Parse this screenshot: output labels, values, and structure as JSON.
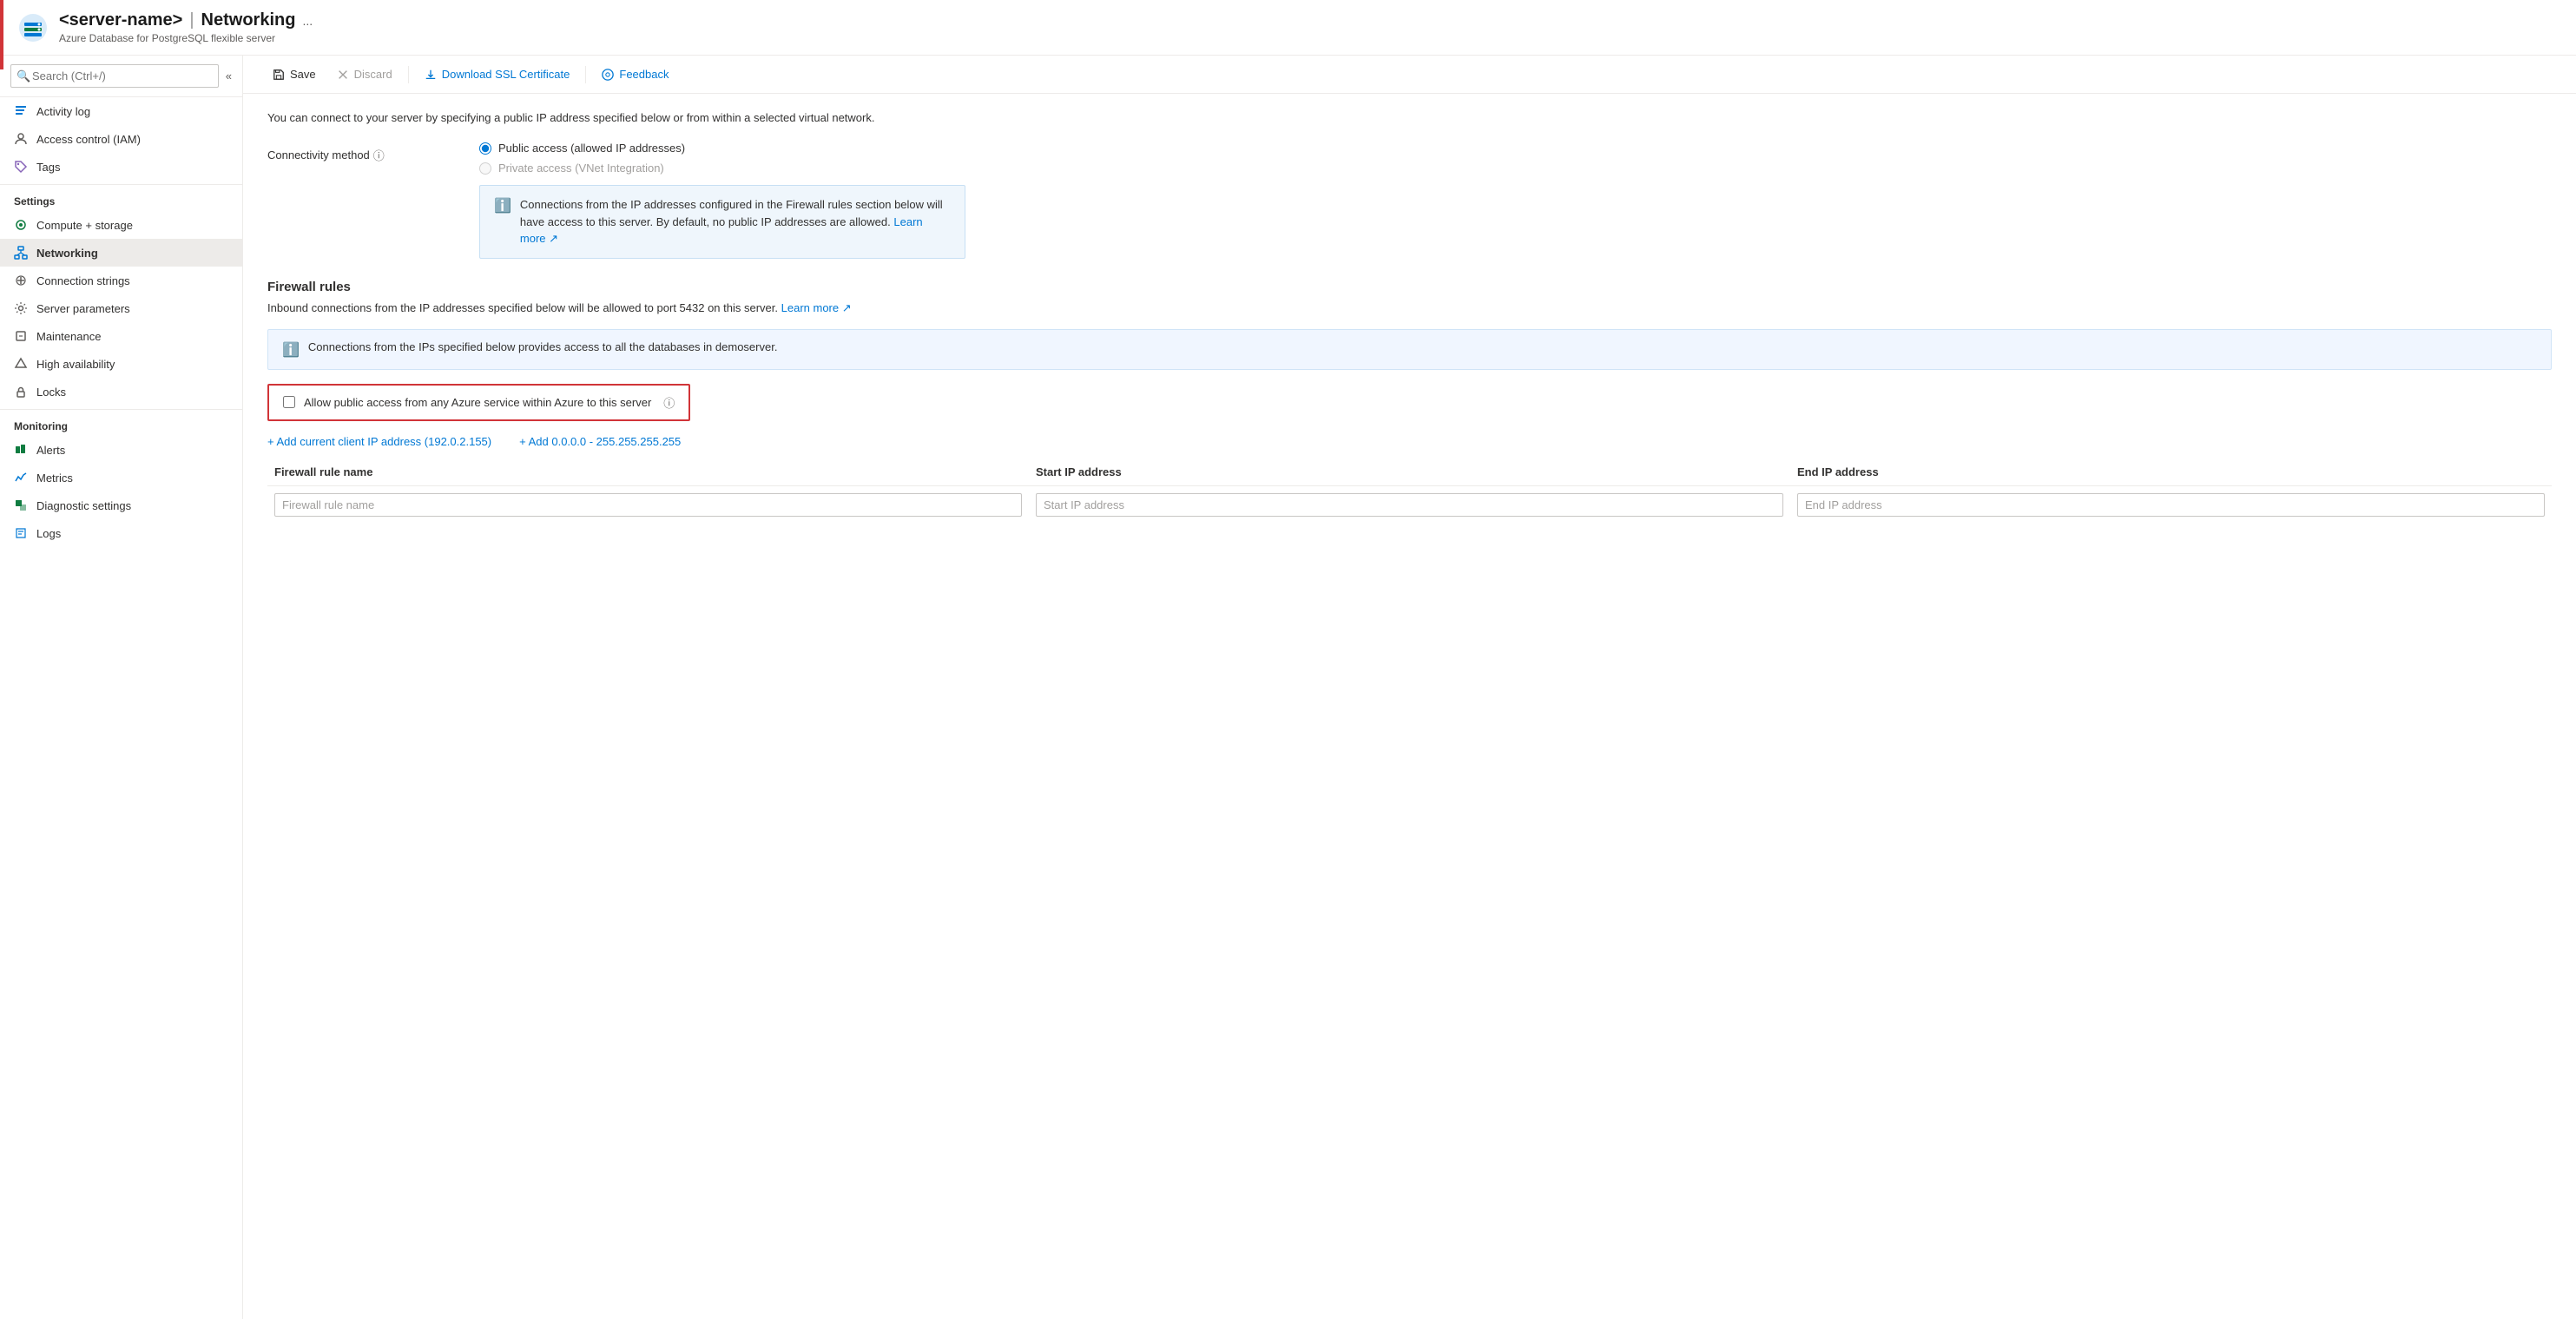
{
  "header": {
    "server_name": "<server-name>",
    "page_title": "Networking",
    "subtitle": "Azure Database for PostgreSQL flexible server",
    "more_label": "...",
    "icon_alt": "postgres-server-icon"
  },
  "toolbar": {
    "save_label": "Save",
    "discard_label": "Discard",
    "download_ssl_label": "Download SSL Certificate",
    "feedback_label": "Feedback"
  },
  "sidebar": {
    "search_placeholder": "Search (Ctrl+/)",
    "items_top": [
      {
        "id": "activity-log",
        "label": "Activity log",
        "icon": "activity"
      },
      {
        "id": "access-control",
        "label": "Access control (IAM)",
        "icon": "iam"
      },
      {
        "id": "tags",
        "label": "Tags",
        "icon": "tag"
      }
    ],
    "settings_label": "Settings",
    "settings_items": [
      {
        "id": "compute-storage",
        "label": "Compute + storage",
        "icon": "compute"
      },
      {
        "id": "networking",
        "label": "Networking",
        "icon": "networking",
        "active": true
      },
      {
        "id": "connection-strings",
        "label": "Connection strings",
        "icon": "connection"
      },
      {
        "id": "server-parameters",
        "label": "Server parameters",
        "icon": "settings"
      },
      {
        "id": "maintenance",
        "label": "Maintenance",
        "icon": "maintenance"
      },
      {
        "id": "high-availability",
        "label": "High availability",
        "icon": "ha"
      },
      {
        "id": "locks",
        "label": "Locks",
        "icon": "lock"
      }
    ],
    "monitoring_label": "Monitoring",
    "monitoring_items": [
      {
        "id": "alerts",
        "label": "Alerts",
        "icon": "alerts"
      },
      {
        "id": "metrics",
        "label": "Metrics",
        "icon": "metrics"
      },
      {
        "id": "diagnostic-settings",
        "label": "Diagnostic settings",
        "icon": "diagnostic"
      },
      {
        "id": "logs",
        "label": "Logs",
        "icon": "logs"
      }
    ]
  },
  "content": {
    "description": "You can connect to your server by specifying a public IP address specified below or from within a selected virtual network.",
    "connectivity_label": "Connectivity method",
    "radio_public": "Public access (allowed IP addresses)",
    "radio_private": "Private access (VNet Integration)",
    "info_box_text": "Connections from the IP addresses configured in the Firewall rules section below will have access to this server. By default, no public IP addresses are allowed.",
    "info_learn_more": "Learn more",
    "firewall_section_title": "Firewall rules",
    "firewall_description": "Inbound connections from the IP addresses specified below will be allowed to port 5432 on this server.",
    "firewall_learn_more": "Learn more",
    "alert_text": "Connections from the IPs specified below provides access to all the databases in demoserver.",
    "checkbox_label": "Allow public access from any Azure service within Azure to this server",
    "add_client_ip_link": "+ Add current client IP address (192.0.2.155)",
    "add_all_ip_link": "+ Add 0.0.0.0 - 255.255.255.255",
    "table": {
      "col1": "Firewall rule name",
      "col2": "Start IP address",
      "col3": "End IP address",
      "row1": {
        "col1_placeholder": "Firewall rule name",
        "col2_placeholder": "Start IP address",
        "col3_placeholder": "End IP address"
      }
    }
  }
}
